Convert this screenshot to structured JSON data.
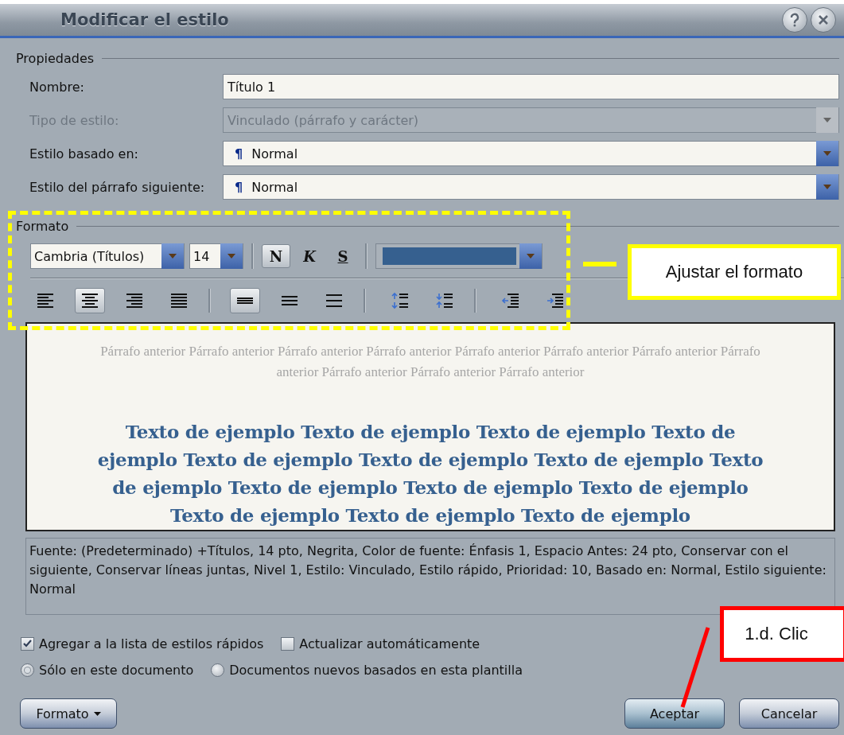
{
  "window": {
    "title": "Modificar el estilo"
  },
  "properties": {
    "heading": "Propiedades",
    "fields": [
      {
        "label": "Nombre:",
        "value": "Título 1",
        "kind": "text",
        "disabled": false
      },
      {
        "label": "Tipo de estilo:",
        "value": "Vinculado (párrafo y carácter)",
        "kind": "dropdown",
        "disabled": true
      },
      {
        "label": "Estilo basado en:",
        "symbol": "¶",
        "value": "Normal",
        "kind": "dropdown",
        "disabled": false
      },
      {
        "label": "Estilo del párrafo siguiente:",
        "symbol": "¶",
        "value": "Normal",
        "kind": "dropdown",
        "disabled": false
      }
    ]
  },
  "format": {
    "heading": "Formato",
    "font": "Cambria (Títulos)",
    "size": "14",
    "color": "#36608f",
    "style_buttons": [
      {
        "label": "N",
        "kind": "bold",
        "selected": true
      },
      {
        "label": "K",
        "kind": "italic",
        "selected": false
      },
      {
        "label": "S",
        "kind": "underline",
        "selected": false
      }
    ],
    "paragraph_groups": [
      [
        {
          "kind": "align-left",
          "selected": false
        },
        {
          "kind": "align-center",
          "selected": true
        },
        {
          "kind": "align-right",
          "selected": false
        },
        {
          "kind": "justify",
          "selected": false
        }
      ],
      [
        {
          "kind": "single-spacing",
          "selected": true
        },
        {
          "kind": "one-half-spacing",
          "selected": false
        },
        {
          "kind": "double-spacing",
          "selected": false
        }
      ],
      [
        {
          "kind": "increase-spacing",
          "selected": false
        },
        {
          "kind": "decrease-spacing",
          "selected": false
        }
      ],
      [
        {
          "kind": "decrease-indent",
          "selected": false
        },
        {
          "kind": "increase-indent",
          "selected": false
        }
      ]
    ]
  },
  "preview": {
    "previous_text": "Párrafo anterior Párrafo anterior Párrafo anterior Párrafo anterior Párrafo anterior Párrafo anterior Párrafo anterior Párrafo anterior Párrafo anterior Párrafo anterior Párrafo anterior",
    "sample_text": "Texto de ejemplo Texto de ejemplo Texto de ejemplo Texto de ejemplo Texto de ejemplo Texto de ejemplo Texto de ejemplo Texto de ejemplo Texto de ejemplo Texto de ejemplo Texto de ejemplo Texto de ejemplo Texto de ejemplo Texto de ejemplo"
  },
  "description": "Fuente: (Predeterminado) +Títulos, 14 pto, Negrita, Color de fuente: Énfasis 1, Espacio Antes:  24 pto, Conservar con el siguiente, Conservar líneas juntas, Nivel 1, Estilo: Vinculado, Estilo rápido, Prioridad: 10, Basado en: Normal, Estilo siguiente: Normal",
  "checkboxes": [
    {
      "label": "Agregar a la lista de estilos rápidos",
      "checked": true
    },
    {
      "label": "Actualizar automáticamente",
      "checked": false
    }
  ],
  "radios": [
    {
      "label": "Sólo en este documento",
      "selected": true
    },
    {
      "label": "Documentos nuevos basados en esta plantilla",
      "selected": false
    }
  ],
  "buttons": [
    {
      "label": "Formato",
      "kind": "menu"
    },
    {
      "label": "Aceptar",
      "kind": "default"
    },
    {
      "label": "Cancelar",
      "kind": "plain"
    }
  ],
  "annotations": [
    {
      "kind": "frame-callout",
      "text": "Ajustar el formato"
    },
    {
      "kind": "pointer-callout",
      "text": "1.d. Clic"
    }
  ]
}
